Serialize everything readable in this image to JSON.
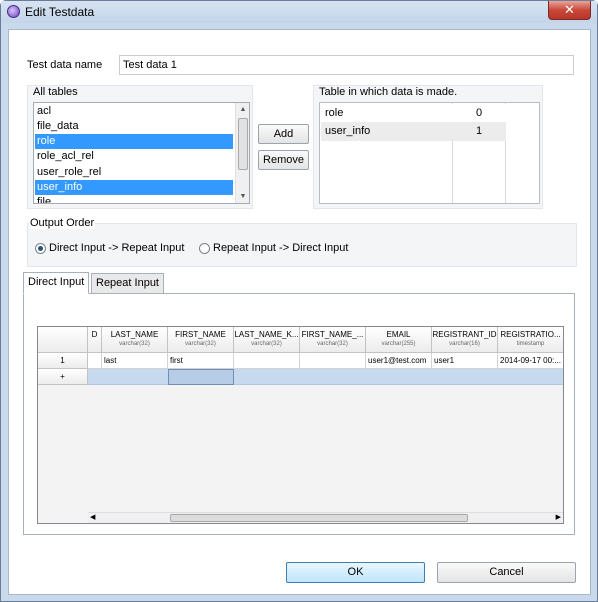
{
  "window": {
    "title": "Edit Testdata",
    "close_label": "✕"
  },
  "form": {
    "name_label": "Test data name",
    "name_value": "Test data 1"
  },
  "all_tables": {
    "label": "All tables",
    "items": [
      "acl",
      "file_data",
      "role",
      "role_acl_rel",
      "user_role_rel",
      "user_info",
      "file"
    ],
    "selected": [
      "role",
      "user_info"
    ]
  },
  "buttons": {
    "add": "Add",
    "remove": "Remove",
    "ok": "OK",
    "cancel": "Cancel"
  },
  "made_tables": {
    "label": "Table in which data is made.",
    "rows": [
      {
        "name": "role",
        "count": "0"
      },
      {
        "name": "user_info",
        "count": "1"
      }
    ]
  },
  "output_order": {
    "label": "Output Order",
    "options": [
      "Direct Input -> Repeat Input",
      "Repeat Input -> Direct Input"
    ],
    "selected": "Direct Input -> Repeat Input"
  },
  "tabs": [
    "Direct Input",
    "Repeat Input"
  ],
  "grid": {
    "columns": [
      {
        "name": "D",
        "type": ""
      },
      {
        "name": "LAST_NAME",
        "type": "varchar(32)"
      },
      {
        "name": "FIRST_NAME",
        "type": "varchar(32)"
      },
      {
        "name": "LAST_NAME_K...",
        "type": "varchar(32)"
      },
      {
        "name": "FIRST_NAME_...",
        "type": "varchar(32)"
      },
      {
        "name": "EMAIL",
        "type": "varchar(255)"
      },
      {
        "name": "REGISTRANT_ID",
        "type": "varchar(16)"
      },
      {
        "name": "REGISTRATIO...",
        "type": "timestamp"
      }
    ],
    "rows": [
      {
        "header": "1",
        "cells": [
          "",
          "last",
          "first",
          "",
          "",
          "user1@test.com",
          "user1",
          "2014-09-17 00:..."
        ]
      }
    ],
    "new_row_header": "+"
  }
}
